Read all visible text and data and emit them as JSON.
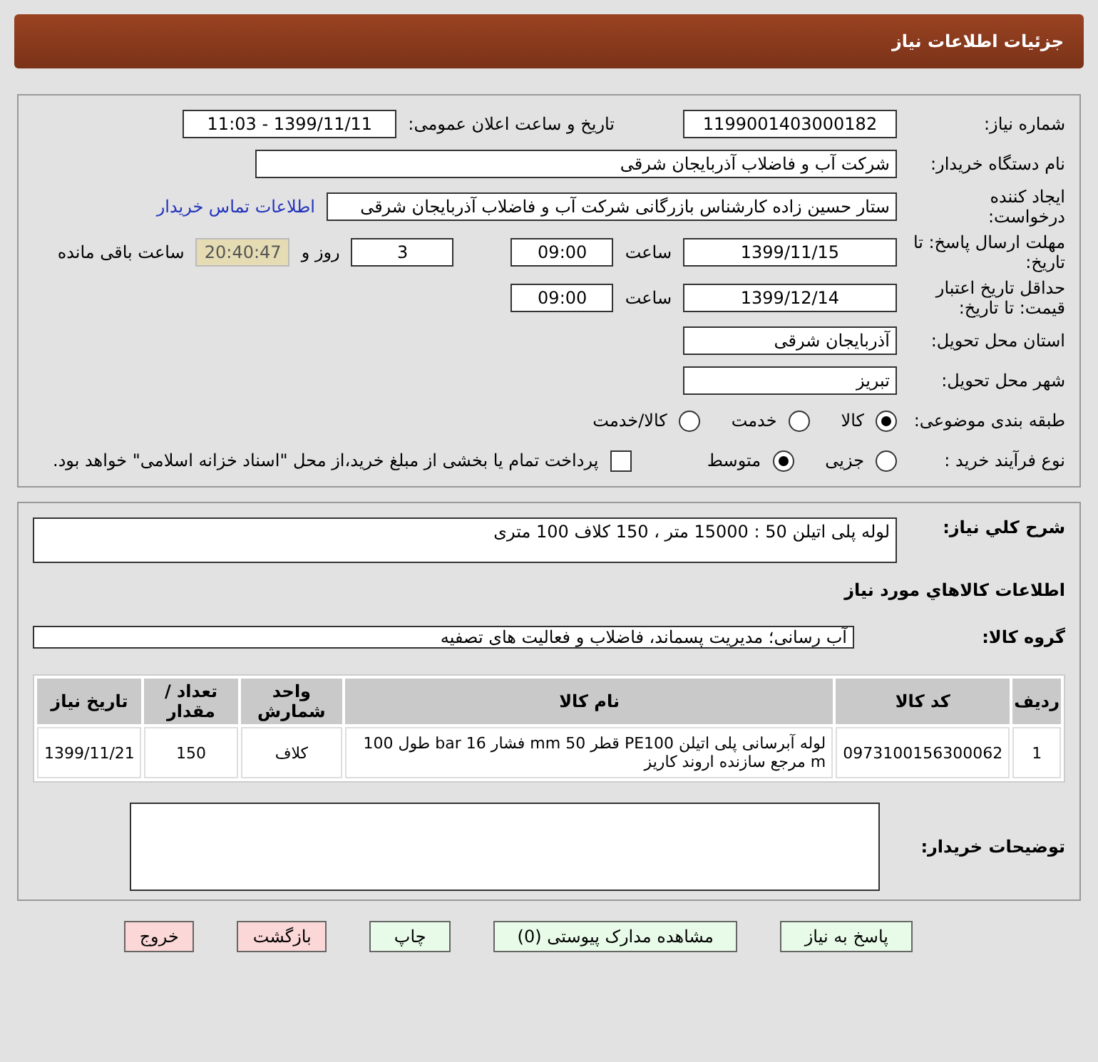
{
  "header": {
    "title": "جزئیات اطلاعات نیاز"
  },
  "need_number": {
    "label": "شماره نیاز:",
    "value": "1199001403000182"
  },
  "announce": {
    "label": "تاریخ و ساعت اعلان عمومی:",
    "value": "1399/11/11 - 11:03"
  },
  "buyer": {
    "label": "نام دستگاه خریدار:",
    "value": "شرکت آب و فاضلاب آذربایجان شرقی"
  },
  "creator": {
    "label": "ایجاد کننده درخواست:",
    "value": "ستار حسین زاده کارشناس بازرگانی شرکت آب و فاضلاب آذربایجان شرقی",
    "link": "اطلاعات تماس خریدار"
  },
  "deadline": {
    "label": "مهلت ارسال پاسخ: تا تاریخ:",
    "date": "1399/11/15",
    "time_label": "ساعت",
    "time": "09:00",
    "days": "3",
    "days_label": "روز و",
    "remaining": "20:40:47",
    "remaining_label": "ساعت باقی مانده"
  },
  "validity": {
    "label": "حداقل تاریخ اعتبار قیمت: تا تاریخ:",
    "date": "1399/12/14",
    "time_label": "ساعت",
    "time": "09:00"
  },
  "province": {
    "label": "استان محل تحویل:",
    "value": "آذربایجان شرقی"
  },
  "city": {
    "label": "شهر محل تحویل:",
    "value": "تبریز"
  },
  "category": {
    "label": "طبقه بندی موضوعی:",
    "options": [
      {
        "label": "کالا",
        "selected": true
      },
      {
        "label": "خدمت",
        "selected": false
      },
      {
        "label": "کالا/خدمت",
        "selected": false
      }
    ]
  },
  "process": {
    "label": "نوع فرآیند خرید :",
    "options": [
      {
        "label": "جزیی",
        "selected": false
      },
      {
        "label": "متوسط",
        "selected": true
      }
    ],
    "treasury": {
      "label": "پرداخت تمام یا بخشی از مبلغ خرید،از محل \"اسناد خزانه اسلامی\" خواهد بود.",
      "checked": false
    }
  },
  "description": {
    "label": "شرح کلي نياز:",
    "value": "لوله پلی اتیلن 50 : 15000 متر ، 150 کلاف 100 متری"
  },
  "goods_heading": "اطلاعات کالاهاي مورد نياز",
  "goods_group": {
    "label": "گروه کالا:",
    "value": "آب رسانی؛ مدیریت پسماند، فاضلاب و فعالیت های تصفیه"
  },
  "table": {
    "columns": [
      "ردیف",
      "کد کالا",
      "نام کالا",
      "واحد شمارش",
      "تعداد / مقدار",
      "تاریخ نیاز"
    ],
    "rows": [
      [
        "1",
        "0973100156300062",
        "لوله آبرسانی پلی اتیلن PE100 قطر 50 mm فشار 16 bar طول 100 m مرجع سازنده اروند کاریز",
        "کلاف",
        "150",
        "1399/11/21"
      ]
    ]
  },
  "buyer_notes": {
    "label": "توضیحات خریدار:"
  },
  "buttons": [
    {
      "label": "پاسخ به نیاز",
      "kind": "action"
    },
    {
      "label": "مشاهده مدارک پیوستی (0)",
      "kind": "action"
    },
    {
      "label": "چاپ",
      "kind": "action"
    },
    {
      "label": "بازگشت",
      "kind": "nav"
    },
    {
      "label": "خروج",
      "kind": "nav"
    }
  ]
}
